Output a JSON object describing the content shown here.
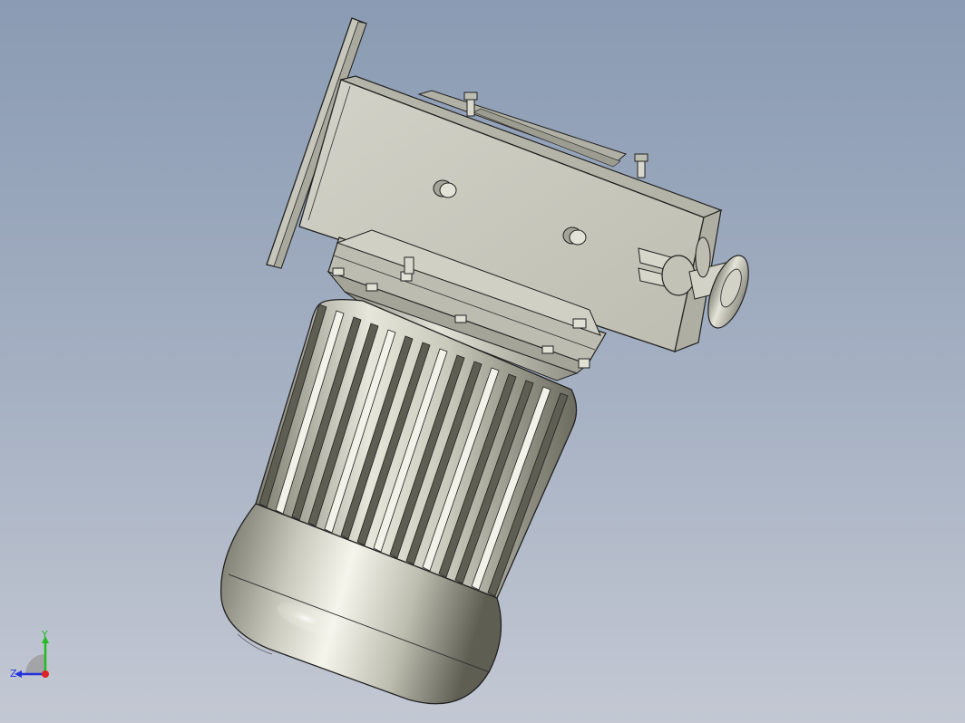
{
  "viewport": {
    "background_top": "#8a9bb3",
    "background_bottom": "#c3c8d3"
  },
  "model": {
    "part_color": "#c8c8bc",
    "outline_color": "#222222",
    "highlight_color": "#f4f4ea",
    "shadow_color": "#6d6d60"
  },
  "triad": {
    "y_label": "Y",
    "z_label": "Z",
    "y_color": "#22bb22",
    "z_color": "#2233dd",
    "x_color": "#dd2222"
  }
}
